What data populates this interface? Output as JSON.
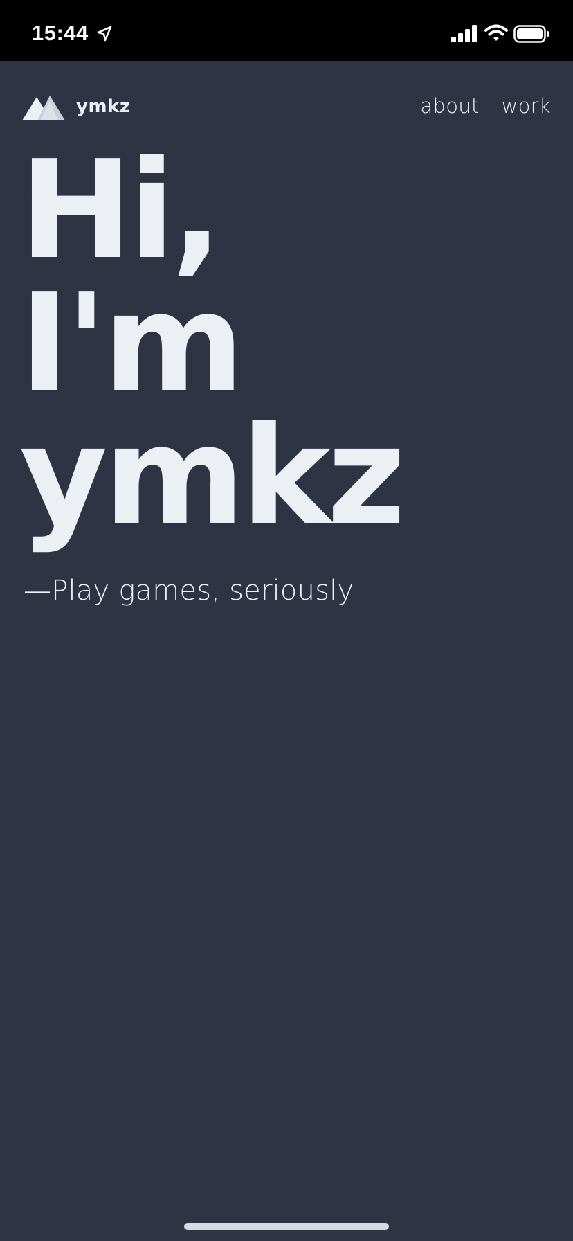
{
  "status_bar": {
    "time": "15:44",
    "icons": [
      "location-arrow-icon",
      "cellular-signal-icon",
      "wifi-icon",
      "battery-icon"
    ]
  },
  "header": {
    "logo_text": "ymkz",
    "logo_icon": "mountain-icon",
    "nav": [
      "about",
      "work"
    ]
  },
  "hero": {
    "lines": [
      "Hi,",
      "I'm",
      "ymkz"
    ]
  },
  "tagline": "—Play games, seriously",
  "colors": {
    "background": "#2e3443",
    "status_bar": "#000000",
    "text": "#eceff4",
    "logo_light": "#eceff4",
    "logo_shade": "#c9cedb",
    "home_indicator": "#d8dbe2"
  }
}
